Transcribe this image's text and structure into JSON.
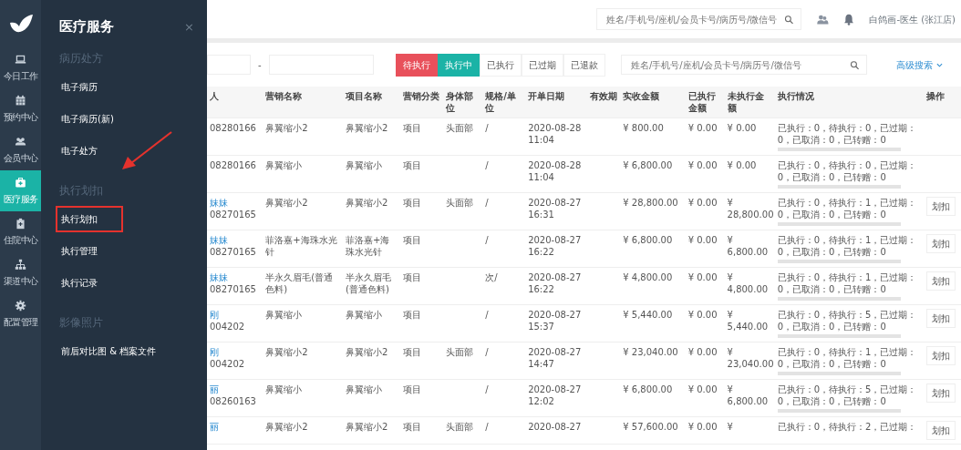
{
  "rail": {
    "items": [
      {
        "label": "今日工作",
        "selected": false
      },
      {
        "label": "预约中心",
        "selected": false
      },
      {
        "label": "会员中心",
        "selected": false
      },
      {
        "label": "医疗服务",
        "selected": true
      },
      {
        "label": "住院中心",
        "selected": false
      },
      {
        "label": "渠道中心",
        "selected": false
      },
      {
        "label": "配置管理",
        "selected": false
      }
    ]
  },
  "flyout": {
    "title": "医疗服务",
    "close": "×",
    "groups": [
      {
        "heading": "病历处方",
        "items": [
          {
            "label": "电子病历",
            "annotated": false
          },
          {
            "label": "电子病历(新)",
            "annotated": false
          },
          {
            "label": "电子处方",
            "annotated": false
          }
        ]
      },
      {
        "heading": "执行划扣",
        "items": [
          {
            "label": "执行划扣",
            "annotated": true
          },
          {
            "label": "执行管理",
            "annotated": false
          },
          {
            "label": "执行记录",
            "annotated": false
          }
        ]
      },
      {
        "heading": "影像照片",
        "items": [
          {
            "label": "前后对比图 & 档案文件",
            "annotated": false
          }
        ]
      }
    ]
  },
  "header": {
    "search": {
      "placeholder": "姓名/手机号/座机/会员卡号/病历号/微信号"
    },
    "user": "白鸽画-医生 (张江店)"
  },
  "filters": {
    "date_separator": "-",
    "statuses": [
      {
        "label": "待执行",
        "selected": true,
        "color": "#e8505b"
      },
      {
        "label": "执行中",
        "selected": true,
        "color": "#1bb3a6"
      },
      {
        "label": "已执行",
        "selected": false
      },
      {
        "label": "已过期",
        "selected": false
      },
      {
        "label": "已退款",
        "selected": false
      }
    ],
    "search": {
      "placeholder": "姓名/手机号/座机/会员卡号/病历号/微信号"
    },
    "advanced_search": "高级搜索"
  },
  "table": {
    "columns": [
      "人",
      "营销名称",
      "项目名称",
      "营销分类",
      "身体部位",
      "规格/单位",
      "开单日期",
      "有效期",
      "实收金额",
      "已执行金额",
      "未执行金额",
      "执行情况",
      "操作"
    ],
    "rows": [
      {
        "customer_no": "08280166",
        "marketing_name": "鼻翼缩小2",
        "item_name": "鼻翼缩小2",
        "category": "项目",
        "body_part": "头面部",
        "spec": "/",
        "date": "2020-08-28 11:04",
        "paid": "¥ 800.00",
        "executed": "¥ 0.00",
        "unexecuted": "¥ 0.00",
        "status_text": "已执行：0，待执行：0，已过期：0，已取消：0，已转赠：0",
        "level": 0
      },
      {
        "customer_no": "08280166",
        "marketing_name": "鼻翼缩小",
        "item_name": "鼻翼缩小",
        "category": "项目",
        "spec": "/",
        "date": "2020-08-28 11:04",
        "paid": "¥ 6,800.00",
        "executed": "¥ 0.00",
        "unexecuted": "¥ 0.00",
        "status_text": "已执行：0，待执行：0，已过期：0，已取消：0，已转赠：0",
        "level": 0
      },
      {
        "customer_name": "妹妹",
        "customer_no": "08270165",
        "marketing_name": "鼻翼缩小2",
        "item_name": "鼻翼缩小2",
        "category": "项目",
        "body_part": "头面部",
        "spec": "/",
        "date": "2020-08-27 16:31",
        "paid": "¥ 28,800.00",
        "executed": "¥ 0.00",
        "unexecuted": "¥ 28,800.00",
        "status_text": "已执行：0，待执行：1，已过期：0，已取消：0，已转赠：0",
        "level": 0,
        "action": "划扣"
      },
      {
        "customer_name": "妹妹",
        "customer_no": "08270165",
        "marketing_name": "菲洛嘉+海珠水光针",
        "item_name": "菲洛嘉+海珠水光针",
        "category": "项目",
        "spec": "/",
        "date": "2020-08-27 16:22",
        "paid": "¥ 6,800.00",
        "executed": "¥ 0.00",
        "unexecuted": "¥ 6,800.00",
        "status_text": "已执行：0，待执行：1，已过期：0，已取消：0，已转赠：0",
        "level": 0,
        "action": "划扣"
      },
      {
        "customer_name": "妹妹",
        "customer_no": "08270165",
        "marketing_name": "半永久眉毛(普通色料)",
        "item_name": "半永久眉毛(普通色料)",
        "category": "项目",
        "spec": "次/",
        "date": "2020-08-27 16:22",
        "paid": "¥ 4,800.00",
        "executed": "¥ 0.00",
        "unexecuted": "¥ 4,800.00",
        "status_text": "已执行：0，待执行：1，已过期：0，已取消：0，已转赠：0",
        "level": 0,
        "action": "划扣"
      },
      {
        "customer_name": "刚",
        "customer_no": "004202",
        "marketing_name": "鼻翼缩小",
        "item_name": "鼻翼缩小",
        "category": "项目",
        "spec": "/",
        "date": "2020-08-27 15:37",
        "paid": "¥ 5,440.00",
        "executed": "¥ 0.00",
        "unexecuted": "¥ 5,440.00",
        "status_text": "已执行：0，待执行：5，已过期：0，已取消：0，已转赠：0",
        "level": 0,
        "action": "划扣"
      },
      {
        "customer_name": "刚",
        "customer_no": "004202",
        "marketing_name": "鼻翼缩小2",
        "item_name": "鼻翼缩小2",
        "category": "项目",
        "body_part": "头面部",
        "spec": "/",
        "date": "2020-08-27 14:47",
        "paid": "¥ 23,040.00",
        "executed": "¥ 0.00",
        "unexecuted": "¥ 23,040.00",
        "status_text": "已执行：0，待执行：1，已过期：0，已取消：0，已转赠：0",
        "level": 0,
        "action": "划扣"
      },
      {
        "customer_name": "丽",
        "customer_no": "08260163",
        "marketing_name": "鼻翼缩小",
        "item_name": "鼻翼缩小",
        "category": "项目",
        "spec": "/",
        "date": "2020-08-27 12:02",
        "paid": "¥ 6,800.00",
        "executed": "¥ 0.00",
        "unexecuted": "¥ 6,800.00",
        "status_text": "已执行：0，待执行：5，已过期：0，已取消：0，已转赠：0",
        "level": 0,
        "action": "划扣"
      },
      {
        "customer_name": "丽",
        "marketing_name": "鼻翼缩小2",
        "item_name": "鼻翼缩小2",
        "category": "项目",
        "body_part": "头面部",
        "spec": "/",
        "date": "2020-08-27",
        "paid": "¥ 57,600.00",
        "executed": "¥ 0.00",
        "unexecuted": "¥",
        "status_text": "已执行：0，待执行：2，已过期：",
        "action": "划扣"
      }
    ]
  }
}
